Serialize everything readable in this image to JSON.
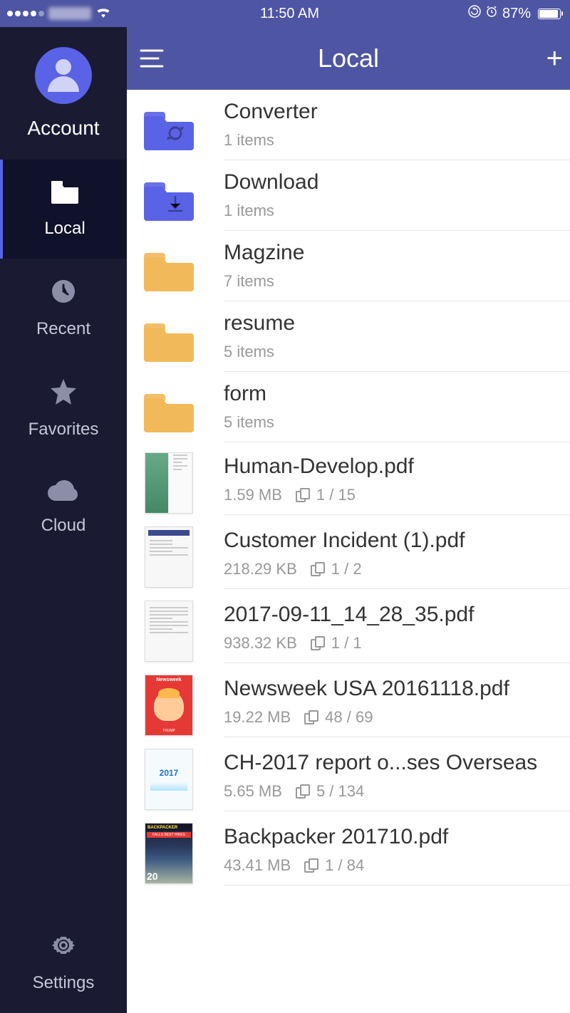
{
  "status_bar": {
    "time": "11:50 AM",
    "battery_percent": "87%"
  },
  "sidebar": {
    "account": {
      "label": "Account"
    },
    "items": [
      {
        "key": "local",
        "label": "Local",
        "active": true
      },
      {
        "key": "recent",
        "label": "Recent",
        "active": false
      },
      {
        "key": "favorites",
        "label": "Favorites",
        "active": false
      },
      {
        "key": "cloud",
        "label": "Cloud",
        "active": false
      }
    ],
    "settings": {
      "label": "Settings"
    }
  },
  "header": {
    "title": "Local",
    "add_label": "+"
  },
  "colors": {
    "folder_blue": "#5a62e6",
    "folder_tan": "#f2b95a",
    "accent": "#4e55a2",
    "sidebar_bg": "#1a1b33"
  },
  "files": [
    {
      "type": "folder",
      "color": "blue",
      "overlay": "sync",
      "name": "Converter",
      "meta": "1 items"
    },
    {
      "type": "folder",
      "color": "blue",
      "overlay": "download",
      "name": "Download",
      "meta": "1 items"
    },
    {
      "type": "folder",
      "color": "tan",
      "overlay": "",
      "name": "Magzine",
      "meta": "7 items"
    },
    {
      "type": "folder",
      "color": "tan",
      "overlay": "",
      "name": "resume",
      "meta": "5 items"
    },
    {
      "type": "folder",
      "color": "tan",
      "overlay": "",
      "name": "form",
      "meta": "5 items"
    },
    {
      "type": "pdf",
      "thumb": "two-page",
      "name": "Human-Develop.pdf",
      "size": "1.59 MB",
      "pages": "1 / 15"
    },
    {
      "type": "pdf",
      "thumb": "form-doc",
      "name": "Customer Incident (1).pdf",
      "size": "218.29 KB",
      "pages": "1 / 2"
    },
    {
      "type": "pdf",
      "thumb": "text-doc",
      "name": "2017-09-11_14_28_35.pdf",
      "size": "938.32 KB",
      "pages": "1 / 1"
    },
    {
      "type": "pdf",
      "thumb": "newsweek",
      "name": "Newsweek USA 20161118.pdf",
      "size": "19.22 MB",
      "pages": "48 / 69"
    },
    {
      "type": "pdf",
      "thumb": "y2017",
      "name": "CH-2017 report o...ses Overseas",
      "size": "5.65 MB",
      "pages": "5 / 134"
    },
    {
      "type": "pdf",
      "thumb": "backpacker",
      "name": "Backpacker 201710.pdf",
      "size": "43.41 MB",
      "pages": "1 / 84"
    }
  ]
}
